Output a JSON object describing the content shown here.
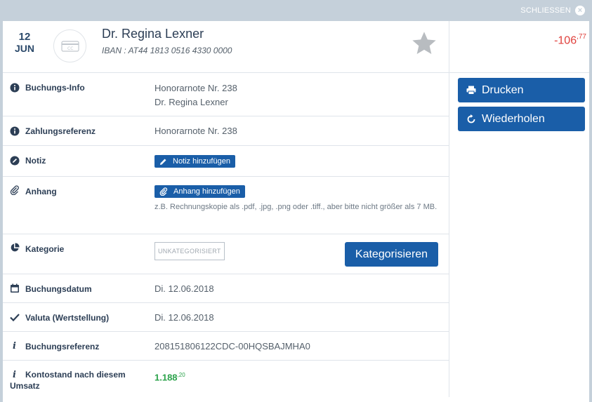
{
  "topbar": {
    "close_label": "SCHLIESSEN"
  },
  "header": {
    "day": "12",
    "month": "JUN",
    "name": "Dr. Regina Lexner",
    "iban": "IBAN : AT44 1813 0516 4330 0000",
    "amount_main": "-106",
    "amount_cents": ",77"
  },
  "rows": {
    "buchungs_info": {
      "label": "Buchungs-Info",
      "line1": "Honorarnote Nr. 238",
      "line2": "Dr. Regina Lexner"
    },
    "zahlungsreferenz": {
      "label": "Zahlungsreferenz",
      "value": "Honorarnote Nr. 238"
    },
    "notiz": {
      "label": "Notiz",
      "button": "Notiz hinzufügen"
    },
    "anhang": {
      "label": "Anhang",
      "button": "Anhang hinzufügen",
      "hint": "z.B. Rechnungskopie als .pdf, .jpg, .png oder .tiff., aber bitte nicht größer als 7 MB."
    },
    "kategorie": {
      "label": "Kategorie",
      "badge": "UNKATEGORISIERT",
      "button": "Kategorisieren"
    },
    "buchungsdatum": {
      "label": "Buchungsdatum",
      "value": "Di. 12.06.2018"
    },
    "valuta": {
      "label": "Valuta (Wertstellung)",
      "value": "Di. 12.06.2018"
    },
    "buchungsreferenz": {
      "label": "Buchungsreferenz",
      "value": "208151806122CDC-00HQSBAJMHA0"
    },
    "kontostand": {
      "label": "Kontostand nach diesem Umsatz",
      "value_main": "1.188",
      "value_cents": ",20"
    }
  },
  "actions": {
    "print_label": "Drucken",
    "repeat_label": "Wiederholen"
  },
  "colors": {
    "primary": "#1a5ea8",
    "negative": "#e0403c",
    "positive": "#2aa24a",
    "frame": "#c5d0da"
  },
  "icons": [
    "close-icon",
    "card-icon",
    "star-icon",
    "info-icon",
    "pencil-icon",
    "paperclip-icon",
    "pie-chart-icon",
    "calendar-icon",
    "checkmark-icon",
    "print-icon",
    "repeat-icon"
  ]
}
